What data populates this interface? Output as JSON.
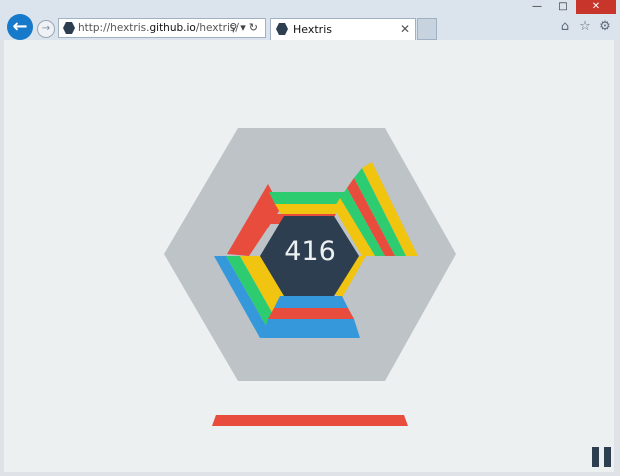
{
  "browser": {
    "url_prefix": "http://hextris.",
    "url_domain": "github.io",
    "url_suffix": "/hextris/",
    "tab_title": "Hextris",
    "icons": [
      "back-icon",
      "forward-icon",
      "search-icon",
      "refresh-icon",
      "close-icon",
      "home-icon",
      "star-icon",
      "gear-icon"
    ]
  },
  "game": {
    "score": "416",
    "colors": {
      "red": "#e74c3c",
      "yellow": "#f1c40f",
      "blue": "#3498db",
      "green": "#2ecc71",
      "center": "#2c3e50",
      "outer_hex": "#bdc3c7",
      "background": "#ecf0f1"
    },
    "stacks": [
      {
        "side": "upper-left",
        "blocks": [
          "red",
          "red"
        ]
      },
      {
        "side": "top",
        "blocks": [
          "red",
          "yellow",
          "green"
        ]
      },
      {
        "side": "upper-right",
        "blocks": [
          "red",
          "green",
          "red",
          "green",
          "yellow"
        ]
      },
      {
        "side": "lower-right",
        "blocks": [
          "yellow"
        ]
      },
      {
        "side": "bottom",
        "blocks": [
          "blue",
          "red",
          "blue"
        ]
      },
      {
        "side": "lower-left",
        "blocks": [
          "yellow",
          "green",
          "yellow",
          "blue"
        ]
      }
    ],
    "falling_block": "red"
  }
}
